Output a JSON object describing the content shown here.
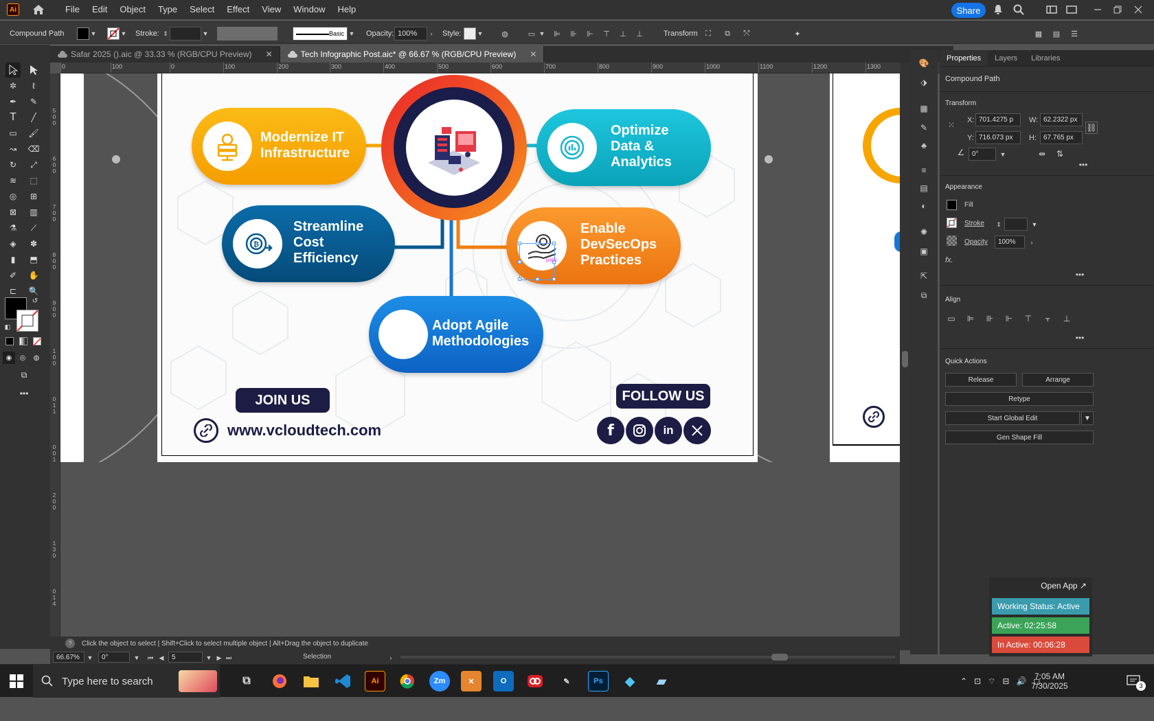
{
  "menubar": {
    "app_logo": "Ai",
    "items": [
      "File",
      "Edit",
      "Object",
      "Type",
      "Select",
      "Effect",
      "View",
      "Window",
      "Help"
    ],
    "share_label": "Share"
  },
  "control_bar": {
    "object_type": "Compound Path",
    "stroke_label": "Stroke:",
    "brush_label": "Basic",
    "opacity_label": "Opacity:",
    "opacity_value": "100%",
    "style_label": "Style:",
    "transform_label": "Transform"
  },
  "tabs": [
    {
      "label": "Safar 2025 ().aic @ 33.33 % (RGB/CPU Preview)",
      "active": false
    },
    {
      "label": "Tech Infographic Post.aic* @ 66.67 % (RGB/CPU Preview)",
      "active": true
    }
  ],
  "ruler": {
    "h_ticks": [
      "0",
      "100",
      "0",
      "100",
      "200",
      "300",
      "400",
      "500",
      "600",
      "700",
      "800",
      "900",
      "1000",
      "1100",
      "1200",
      "1300"
    ],
    "v_ticks": [
      "5",
      "0",
      "0",
      "6",
      "0",
      "0",
      "7",
      "0",
      "0",
      "8",
      "0",
      "0",
      "9",
      "0",
      "0",
      "1",
      "0",
      "0",
      "0",
      "1",
      "1",
      "0",
      "0",
      "1",
      "2",
      "0",
      "0",
      "1",
      "3",
      "0",
      "0",
      "1",
      "4",
      "0",
      "0"
    ]
  },
  "artboard": {
    "pills": [
      {
        "id": "modernize",
        "label": "Modernize IT Infrastructure",
        "color": "#f7a600",
        "icon": "server-gear-icon"
      },
      {
        "id": "optimize",
        "label": "Optimize Data & Analytics",
        "color": "#16b7cc",
        "icon": "gear-chart-icon"
      },
      {
        "id": "streamline",
        "label": "Streamline Cost Efficiency",
        "color": "#065a8f",
        "icon": "coin-gear-icon"
      },
      {
        "id": "devsecops",
        "label": "Enable DevSecOps Practices",
        "color": "#f07f12",
        "icon": "hand-gear-icon"
      },
      {
        "id": "agile",
        "label": "Adopt Agile Methodologies",
        "color": "#1877d6",
        "icon": ""
      }
    ],
    "join_label": "JOIN US",
    "follow_label": "FOLLOW US",
    "website": "www.vcloudtech.com",
    "social": [
      "facebook-icon",
      "instagram-icon",
      "linkedin-icon",
      "x-icon"
    ],
    "selected_path_label": "path"
  },
  "properties": {
    "tabs": [
      "Properties",
      "Layers",
      "Libraries"
    ],
    "object_type": "Compound Path",
    "transform_title": "Transform",
    "x_label": "X:",
    "x_value": "701.4275 p",
    "y_label": "Y:",
    "y_value": "716.073 px",
    "w_label": "W:",
    "w_value": "62.2322 px",
    "h_label": "H:",
    "h_value": "67.765 px",
    "angle_value": "0°",
    "appearance_title": "Appearance",
    "fill_label": "Fill",
    "stroke_label": "Stroke",
    "opacity_label": "Opacity",
    "opacity_value": "100%",
    "fx_label": "fx.",
    "align_title": "Align",
    "quick_actions_title": "Quick Actions",
    "release_btn": "Release",
    "arrange_btn": "Arrange",
    "retype_btn": "Retype",
    "global_edit_btn": "Start Global Edit",
    "gen_shape_btn": "Gen Shape Fill"
  },
  "widget": {
    "open_app": "Open App ↗",
    "working": "Working Status: Active",
    "active": "Active: 02:25:58",
    "inactive": "In Active: 00:06:28",
    "colors": {
      "working": "#3a9bad",
      "active": "#3aa357",
      "inactive": "#d94a3b"
    }
  },
  "statusbar": {
    "hint": "Click the object to select  |  Shift+Click to select multiple object  |  Alt+Drag the object to duplicate",
    "zoom": "66.67%",
    "rotation": "0°",
    "artboard_num": "5",
    "tool": "Selection"
  },
  "taskbar": {
    "search_placeholder": "Type here to search",
    "time": "7:05 AM",
    "date": "7/30/2025",
    "notif_count": "3",
    "apps": [
      "Zm",
      "Ai",
      "Ps"
    ]
  }
}
